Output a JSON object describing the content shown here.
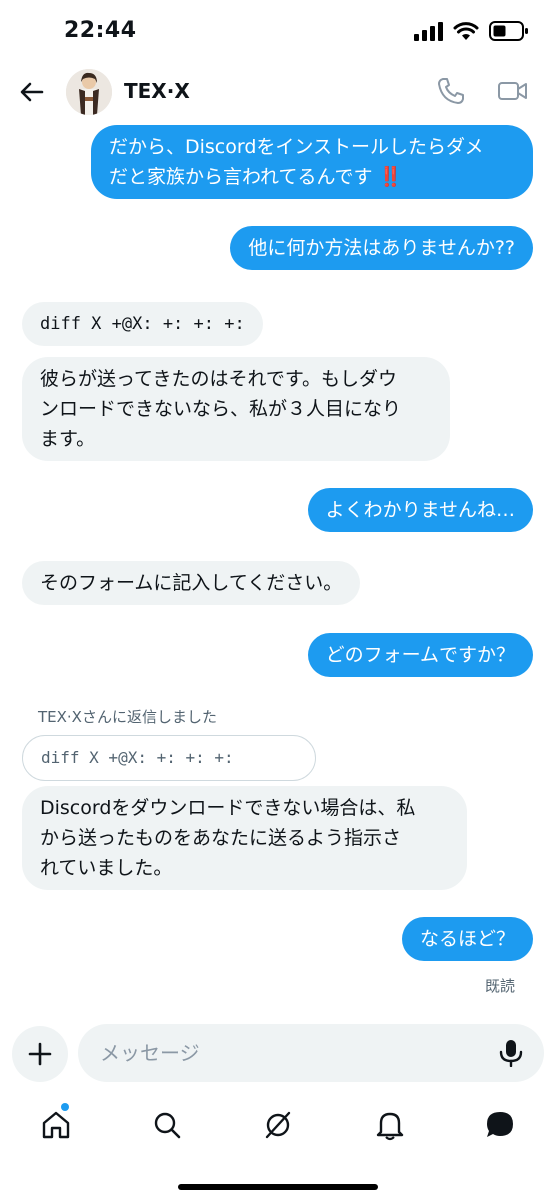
{
  "status_bar": {
    "time": "22:44"
  },
  "header": {
    "contact_name": "TEX·X"
  },
  "messages": {
    "m1": "だから、Discordをインストールしたらダメ\nだと家族から言われてるんです ‼️",
    "m2": "他に何か方法はありませんか??",
    "m3": "diff X +@X:  +:  +:  +:",
    "m4": "彼らが送ってきたのはそれです。もしダウ\nンロードできないなら、私が３人目になり\nます。",
    "m5": "よくわかりませんね…",
    "m6": "そのフォームに記入してください。",
    "m7": "どのフォームですか？",
    "reply_label": "TEX·Xさんに返信しました",
    "quoted": "diff X +@X:  +:  +:  +:",
    "m8": "Discordをダウンロードできない場合は、私\nから送ったものをあなたに送るよう指示さ\nれていました。",
    "m9": "なるほど？",
    "read_receipt": "既読"
  },
  "composer": {
    "placeholder": "メッセージ"
  },
  "nav": {
    "icons": [
      "home-icon",
      "search-icon",
      "communities-icon",
      "bell-icon",
      "messages-icon"
    ],
    "accent": "#1d9bf0"
  },
  "colors": {
    "outgoing_bubble": "#1d9bf0",
    "incoming_bubble": "#eff3f4",
    "secondary_text": "#536471"
  }
}
